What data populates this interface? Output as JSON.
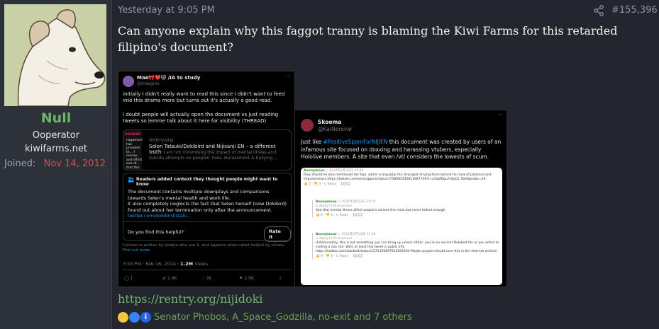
{
  "user": {
    "name": "Null",
    "title": "Ooperator",
    "site": "kiwifarms.net",
    "joined_label": "Joined:",
    "joined_date": "Nov 14, 2012"
  },
  "post": {
    "date": "Yesterday at 9:05 PM",
    "number": "#155,396",
    "text": "Can anyone explain why this faggot tranny is blaming the Kiwi Farms for this retarded filipino's document?",
    "link": "https://rentry.org/nijidoki",
    "reactions": "Senator Phobos, A_Space_Godzilla, no-exit and 7 others"
  },
  "tweet1": {
    "name": "Mae🎀❤️😿 /IA to study",
    "handle": "@maegixx",
    "para1": "initially I didn't really want to read this since I didn't want to feed into this drama more but turns out it's actually a good read.",
    "para2": "I doubt people will actually open the document vs just reading tweets so lemme talk about it here for visibility (THREAD)",
    "card_thumb_text": "nagement has privated th... f money and effort was dr... that this happened on our... ll be able to listen to th...",
    "card_domain": "rentry.org",
    "card_title": "Selen Tatsuki/Dokibird and Nijisanji EN – a different truth",
    "card_desc": "NOTE: I am not minimising the impact of mental illness and suicide attempts on peoples' lives. Harassment & bullying ...",
    "note_header": "Readers added context they thought people might want to know",
    "note_body1": "The document contains multiple downplays and comparisons towards Selen's mental health and work life.",
    "note_body2": "It also completely neglects the fact that Selen herself (now Dokibird) found out about her termination only after the announcement.",
    "note_link": "twitter.com/dokibird/statu...",
    "note_question": "Do you find this helpful?",
    "rate_button": "Rate it",
    "note_footer": "Context is written by people who use X, and appears when rated helpful by others.",
    "note_footer_link": "Find out more.",
    "timestamp": "3:03 PM · Feb 16, 2024 ·",
    "views": "1.2M",
    "views_label": "Views",
    "replies": "1",
    "retweets": "1.9K",
    "likes": "3K",
    "bookmarks": "2.9K"
  },
  "tweet2": {
    "name": "Skooma",
    "handle": "@KaiNerevar",
    "text_pre": "Just like",
    "hashtag": "#PositiveSpamForNIJIEN",
    "text_post": "this document was created by users of an infamous site focused on doxxing and harassing vtubers, especially Hololive members. A site that even /vt/ considers the lowests of scum.",
    "comments": [
      {
        "author": "Anonymous",
        "meta": "○ 2024年2月12日 21:06",
        "reply_to": "",
        "body": "they should've also mentioned her tepi, which is arguably the strongest driving force behind her lack of patience and impulsiveness https://twitter.com/verstappen/status/1758085240611687756?t=u5qkfBgu7xKyOz_fGkNpou&s=19",
        "actions": "👍 7 · 👎 0 · ↳ Reply · 【返信】"
      },
      {
        "author": "Anonymous",
        "meta": "○ 2024年2月13日 22:10",
        "reply_to": "↳ Reply to Anonymous",
        "body": "Sad that mental illness affect people's actions the most but never talked enough.",
        "actions": "👍 0 · 👎 0 · ↳ Reply · 【返信】"
      },
      {
        "author": "Anonymous",
        "meta": "○ 2024年2月13日 11:30",
        "reply_to": "↳ Reply to Anonymous",
        "body": "Unfortunately, this is not something you can bring up unless either, you're an ancient Dokibird fan or you admit to visiting a dox site. Well, at least this tweet is public info https://twitter.com/dokibird/status/1275336897910206464 Maybe people should save this in the internet archive.",
        "actions": "👍 0 · 👎 0 · ↳ Reply · 【返信】"
      }
    ]
  },
  "colors": {
    "username": "#6eb36b",
    "joined_date": "#d2514f",
    "link": "#6eb36b",
    "twitter_blue": "#1d9bf0"
  },
  "icons": [
    "share-icon",
    "reply-icon",
    "retweet-icon",
    "like-icon",
    "bookmark-icon",
    "views-icon",
    "more-icon",
    "people-icon"
  ]
}
